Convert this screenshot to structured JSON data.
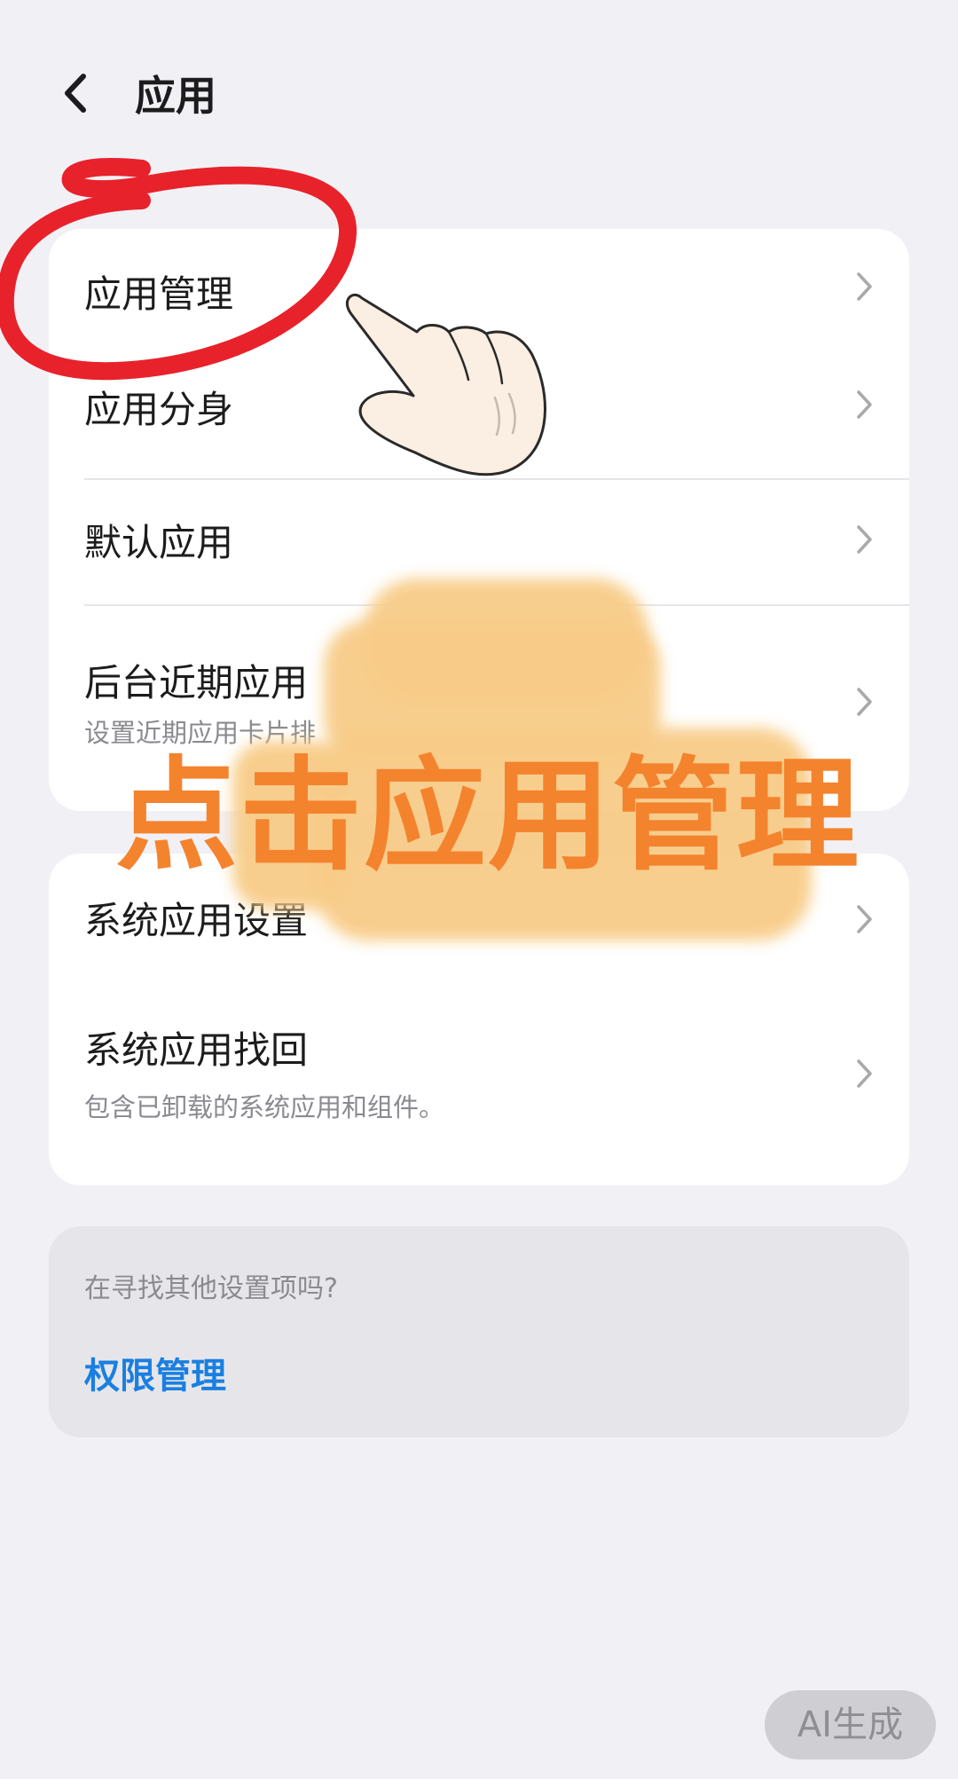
{
  "header": {
    "title": "应用"
  },
  "card1": {
    "items": [
      {
        "label": "应用管理"
      },
      {
        "label": "应用分身"
      },
      {
        "label": "默认应用"
      },
      {
        "label": "后台近期应用",
        "sub": "设置近期应用卡片排"
      }
    ]
  },
  "card2": {
    "items": [
      {
        "label": "系统应用设置"
      },
      {
        "label": "系统应用找回",
        "sub": "包含已卸载的系统应用和组件。"
      }
    ]
  },
  "suggest": {
    "question": "在寻找其他设置项吗?",
    "link": "权限管理"
  },
  "overlay": {
    "caption": "点击应用管理"
  },
  "badge": "AI生成",
  "colors": {
    "background": "#f1f1f5",
    "card": "#ffffff",
    "link": "#1a7fe0",
    "annotation_ring": "#e8222b",
    "caption": "#f4832e",
    "caption_background": "#f8cc88"
  },
  "icons": {
    "back": "chevron-left-icon",
    "row": "chevron-right-icon"
  }
}
